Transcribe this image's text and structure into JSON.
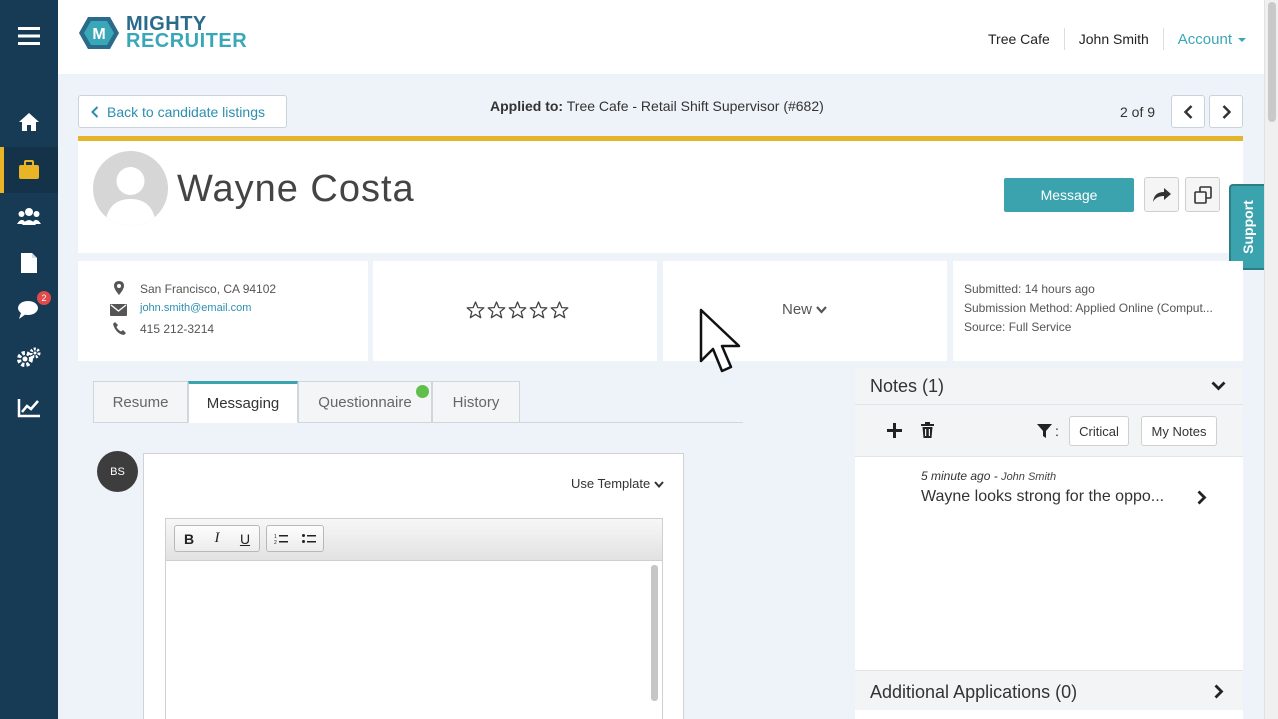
{
  "sidebar": {
    "items": [
      {
        "icon": "menu-icon"
      },
      {
        "icon": "home-icon"
      },
      {
        "icon": "briefcase-icon",
        "active": true
      },
      {
        "icon": "users-icon"
      },
      {
        "icon": "document-icon"
      },
      {
        "icon": "chat-icon",
        "badge": "2"
      },
      {
        "icon": "settings-icon"
      },
      {
        "icon": "chart-icon"
      }
    ],
    "accent": "#e9b526",
    "background": "#173a55"
  },
  "header": {
    "logo_line1": "MIGHTY",
    "logo_line2": "RECRUITER",
    "company": "Tree Cafe",
    "user": "John Smith",
    "account_label": "Account"
  },
  "nav": {
    "back_label": "Back to candidate listings",
    "applied_label": "Applied to:",
    "applied_value": "Tree Cafe - Retail Shift Supervisor (#682)",
    "pager": "2 of 9"
  },
  "candidate": {
    "name": "Wayne Costa",
    "message_label": "Message",
    "location": "San Francisco, CA 94102",
    "email": "john.smith@email.com",
    "phone": "415 212-3214",
    "rating": 0,
    "rating_max": 5,
    "status": "New",
    "submitted": "Submitted: 14 hours ago",
    "submission_method": "Submission Method: Applied Online (Comput...",
    "source": "Source: Full Service"
  },
  "support_label": "Support",
  "tabs": [
    {
      "label": "Resume"
    },
    {
      "label": "Messaging",
      "active": true
    },
    {
      "label": "Questionnaire"
    },
    {
      "label": "History"
    }
  ],
  "composer": {
    "avatar_initials": "BS",
    "use_template_label": "Use Template",
    "toolbar": [
      "bold-icon",
      "italic-icon",
      "underline-icon",
      "ordered-list-icon",
      "bullet-list-icon"
    ]
  },
  "notes": {
    "title": "Notes (1)",
    "filter_critical": "Critical",
    "filter_my_notes": "My Notes",
    "filter_sep": ":",
    "items": [
      {
        "time": "5 minute ago",
        "author": "John Smith",
        "text": "Wayne looks strong for the oppo..."
      }
    ],
    "additional_title": "Additional Applications (0)"
  },
  "colors": {
    "teal": "#3aa3ae",
    "link": "#2b8fb0",
    "gold": "#e4b52b"
  }
}
